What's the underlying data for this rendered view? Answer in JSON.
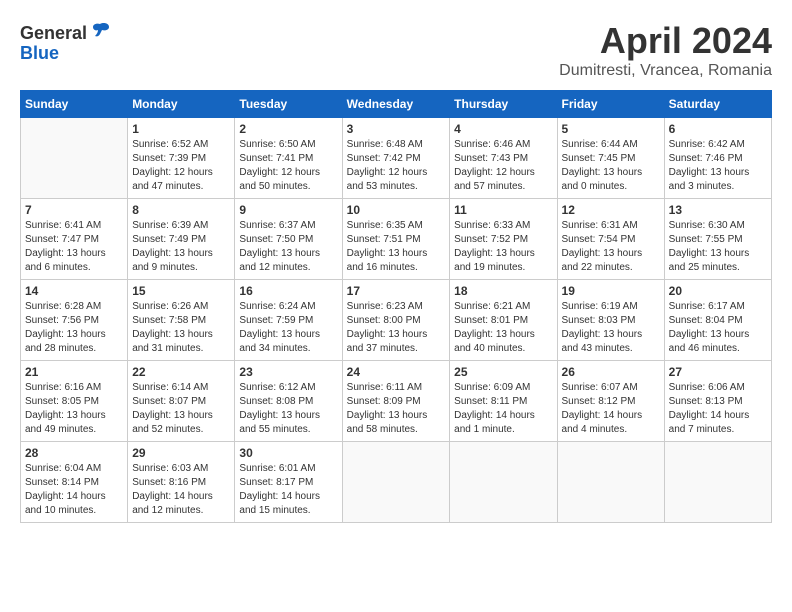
{
  "header": {
    "logo_general": "General",
    "logo_blue": "Blue",
    "month_year": "April 2024",
    "location": "Dumitresti, Vrancea, Romania"
  },
  "calendar": {
    "days_of_week": [
      "Sunday",
      "Monday",
      "Tuesday",
      "Wednesday",
      "Thursday",
      "Friday",
      "Saturday"
    ],
    "weeks": [
      [
        {
          "day": "",
          "info": ""
        },
        {
          "day": "1",
          "info": "Sunrise: 6:52 AM\nSunset: 7:39 PM\nDaylight: 12 hours\nand 47 minutes."
        },
        {
          "day": "2",
          "info": "Sunrise: 6:50 AM\nSunset: 7:41 PM\nDaylight: 12 hours\nand 50 minutes."
        },
        {
          "day": "3",
          "info": "Sunrise: 6:48 AM\nSunset: 7:42 PM\nDaylight: 12 hours\nand 53 minutes."
        },
        {
          "day": "4",
          "info": "Sunrise: 6:46 AM\nSunset: 7:43 PM\nDaylight: 12 hours\nand 57 minutes."
        },
        {
          "day": "5",
          "info": "Sunrise: 6:44 AM\nSunset: 7:45 PM\nDaylight: 13 hours\nand 0 minutes."
        },
        {
          "day": "6",
          "info": "Sunrise: 6:42 AM\nSunset: 7:46 PM\nDaylight: 13 hours\nand 3 minutes."
        }
      ],
      [
        {
          "day": "7",
          "info": "Sunrise: 6:41 AM\nSunset: 7:47 PM\nDaylight: 13 hours\nand 6 minutes."
        },
        {
          "day": "8",
          "info": "Sunrise: 6:39 AM\nSunset: 7:49 PM\nDaylight: 13 hours\nand 9 minutes."
        },
        {
          "day": "9",
          "info": "Sunrise: 6:37 AM\nSunset: 7:50 PM\nDaylight: 13 hours\nand 12 minutes."
        },
        {
          "day": "10",
          "info": "Sunrise: 6:35 AM\nSunset: 7:51 PM\nDaylight: 13 hours\nand 16 minutes."
        },
        {
          "day": "11",
          "info": "Sunrise: 6:33 AM\nSunset: 7:52 PM\nDaylight: 13 hours\nand 19 minutes."
        },
        {
          "day": "12",
          "info": "Sunrise: 6:31 AM\nSunset: 7:54 PM\nDaylight: 13 hours\nand 22 minutes."
        },
        {
          "day": "13",
          "info": "Sunrise: 6:30 AM\nSunset: 7:55 PM\nDaylight: 13 hours\nand 25 minutes."
        }
      ],
      [
        {
          "day": "14",
          "info": "Sunrise: 6:28 AM\nSunset: 7:56 PM\nDaylight: 13 hours\nand 28 minutes."
        },
        {
          "day": "15",
          "info": "Sunrise: 6:26 AM\nSunset: 7:58 PM\nDaylight: 13 hours\nand 31 minutes."
        },
        {
          "day": "16",
          "info": "Sunrise: 6:24 AM\nSunset: 7:59 PM\nDaylight: 13 hours\nand 34 minutes."
        },
        {
          "day": "17",
          "info": "Sunrise: 6:23 AM\nSunset: 8:00 PM\nDaylight: 13 hours\nand 37 minutes."
        },
        {
          "day": "18",
          "info": "Sunrise: 6:21 AM\nSunset: 8:01 PM\nDaylight: 13 hours\nand 40 minutes."
        },
        {
          "day": "19",
          "info": "Sunrise: 6:19 AM\nSunset: 8:03 PM\nDaylight: 13 hours\nand 43 minutes."
        },
        {
          "day": "20",
          "info": "Sunrise: 6:17 AM\nSunset: 8:04 PM\nDaylight: 13 hours\nand 46 minutes."
        }
      ],
      [
        {
          "day": "21",
          "info": "Sunrise: 6:16 AM\nSunset: 8:05 PM\nDaylight: 13 hours\nand 49 minutes."
        },
        {
          "day": "22",
          "info": "Sunrise: 6:14 AM\nSunset: 8:07 PM\nDaylight: 13 hours\nand 52 minutes."
        },
        {
          "day": "23",
          "info": "Sunrise: 6:12 AM\nSunset: 8:08 PM\nDaylight: 13 hours\nand 55 minutes."
        },
        {
          "day": "24",
          "info": "Sunrise: 6:11 AM\nSunset: 8:09 PM\nDaylight: 13 hours\nand 58 minutes."
        },
        {
          "day": "25",
          "info": "Sunrise: 6:09 AM\nSunset: 8:11 PM\nDaylight: 14 hours\nand 1 minute."
        },
        {
          "day": "26",
          "info": "Sunrise: 6:07 AM\nSunset: 8:12 PM\nDaylight: 14 hours\nand 4 minutes."
        },
        {
          "day": "27",
          "info": "Sunrise: 6:06 AM\nSunset: 8:13 PM\nDaylight: 14 hours\nand 7 minutes."
        }
      ],
      [
        {
          "day": "28",
          "info": "Sunrise: 6:04 AM\nSunset: 8:14 PM\nDaylight: 14 hours\nand 10 minutes."
        },
        {
          "day": "29",
          "info": "Sunrise: 6:03 AM\nSunset: 8:16 PM\nDaylight: 14 hours\nand 12 minutes."
        },
        {
          "day": "30",
          "info": "Sunrise: 6:01 AM\nSunset: 8:17 PM\nDaylight: 14 hours\nand 15 minutes."
        },
        {
          "day": "",
          "info": ""
        },
        {
          "day": "",
          "info": ""
        },
        {
          "day": "",
          "info": ""
        },
        {
          "day": "",
          "info": ""
        }
      ]
    ]
  }
}
